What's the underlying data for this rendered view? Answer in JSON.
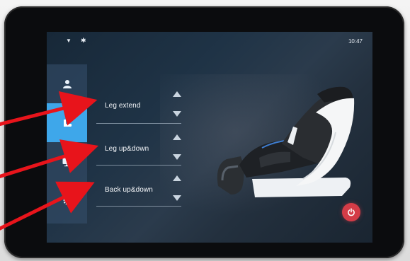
{
  "status_bar": {
    "time": "10:47",
    "icons": [
      "wifi-icon",
      "bluetooth-icon"
    ]
  },
  "sidebar": {
    "items": [
      {
        "name": "user-icon",
        "active": false
      },
      {
        "name": "foot-icon",
        "active": true
      },
      {
        "name": "monitor-icon",
        "active": false
      },
      {
        "name": "gear-icon",
        "active": false
      }
    ]
  },
  "controls": [
    {
      "label": "Leg extend"
    },
    {
      "label": "Leg up&down"
    },
    {
      "label": "Back up&down"
    }
  ],
  "colors": {
    "accent": "#3ea7ea",
    "power": "#d43c47",
    "annotation_arrow": "#e8141b"
  },
  "power_icon": "power-icon"
}
